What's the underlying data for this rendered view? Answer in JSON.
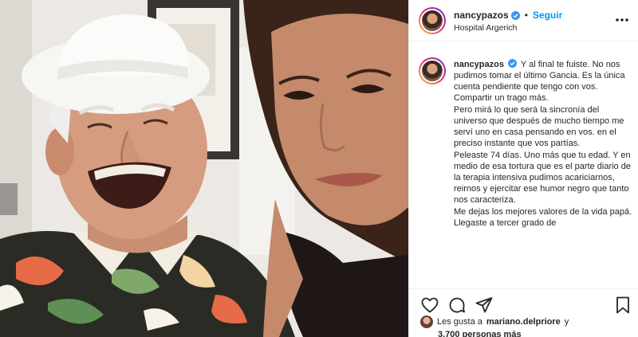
{
  "post": {
    "username": "nancypazos",
    "follow_label": "Seguir",
    "location": "Hospital Argerich",
    "separator": "•"
  },
  "caption": {
    "username": "nancypazos",
    "paragraphs": [
      "Y al final te fuiste. No nos pudimos tomar el último Gancia. Es la única cuenta pendiente que tengo con vos. Compartir un trago más.",
      "Pero mirá lo que será la sincronía del universo que después de mucho tiempo me serví uno en casa pensando en vos. en el preciso instante que vos partías.",
      "Peleaste 74 días. Uno más que tu edad. Y en medio de esa tortura que es el parte diario de la terapia intensiva pudimos acariciarnos, reirnos y ejercitar ese humor negro que tanto nos caracteriza.",
      "Me dejas los mejores valores de la vida papá. Llegaste a tercer grado de"
    ]
  },
  "likes": {
    "prefix": "Les gusta a",
    "user": "mariano.delpriore",
    "suffix": "y",
    "count": "3.700 personas más"
  },
  "icons": {
    "verified": "verified-badge-icon",
    "more": "more-options-icon",
    "like": "heart-icon",
    "comment": "comment-icon",
    "share": "share-icon",
    "save": "bookmark-icon"
  },
  "colors": {
    "accent": "#0095f6",
    "text": "#262626",
    "border": "#efefef"
  }
}
